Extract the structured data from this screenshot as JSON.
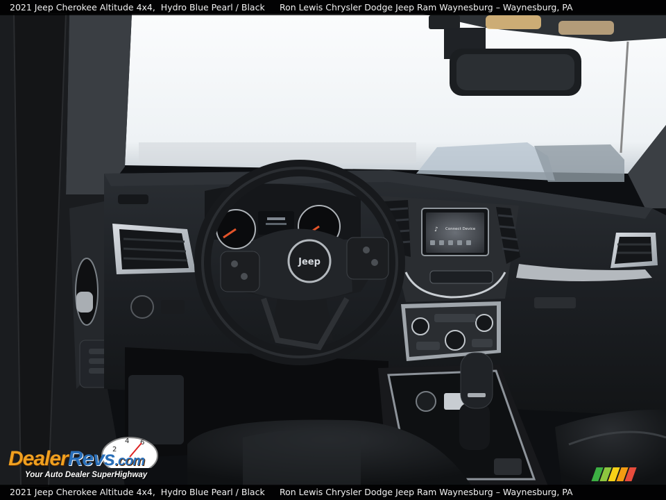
{
  "caption": {
    "vehicle": "2021 Jeep Cherokee Altitude 4x4,  Hydro Blue Pearl / Black",
    "dealer": "Ron Lewis Chrysler Dodge Jeep Ram Waynesburg – Waynesburg, PA"
  },
  "steering_wheel": {
    "badge": "Jeep"
  },
  "infotainment": {
    "status": "Connect Device"
  },
  "watermark": {
    "brand_part1": "Dealer",
    "brand_part2": "Revs",
    "brand_suffix": ".com",
    "tagline": "Your Auto Dealer SuperHighway"
  },
  "colors": {
    "bar_bg": "#000000",
    "brand_orange": "#f0a020",
    "brand_blue": "#2a6fb8",
    "stripes": [
      "#3cb043",
      "#8dc63f",
      "#f7d117",
      "#f39c12",
      "#e74c3c"
    ]
  }
}
